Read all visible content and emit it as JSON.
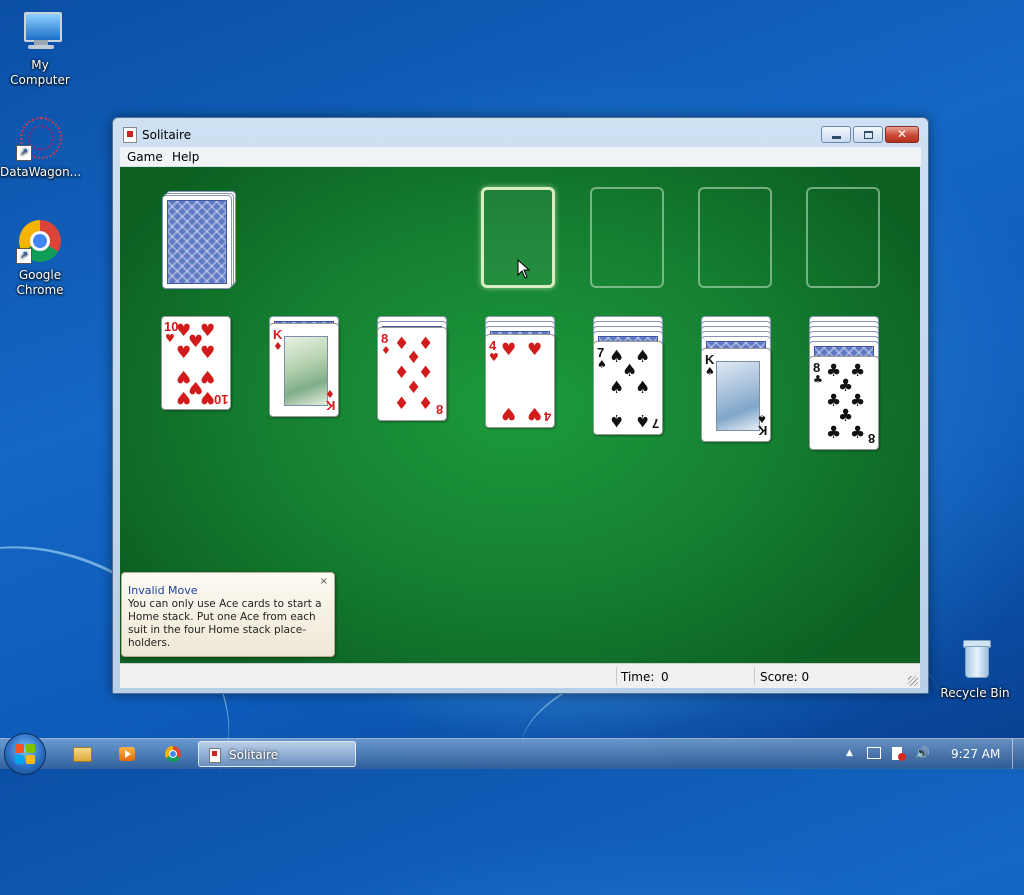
{
  "desktop": {
    "icons": [
      {
        "label": "My Computer"
      },
      {
        "label": "DataWagon..."
      },
      {
        "label": "Google Chrome"
      },
      {
        "label": "Recycle Bin"
      }
    ]
  },
  "window": {
    "title": "Solitaire",
    "menu": [
      "Game",
      "Help"
    ]
  },
  "game": {
    "tableau": [
      {
        "face_down": 0,
        "rank": "10",
        "suit": "hearts"
      },
      {
        "face_down": 1,
        "rank": "K",
        "suit": "diamonds"
      },
      {
        "face_down": 2,
        "rank": "8",
        "suit": "diamonds"
      },
      {
        "face_down": 3,
        "rank": "4",
        "suit": "hearts"
      },
      {
        "face_down": 4,
        "rank": "7",
        "suit": "spades"
      },
      {
        "face_down": 5,
        "rank": "K",
        "suit": "spades"
      },
      {
        "face_down": 6,
        "rank": "8",
        "suit": "clubs"
      }
    ],
    "foundations_empty": 4,
    "highlighted_foundation": 1
  },
  "notification": {
    "title": "Invalid Move",
    "text": "You can only use Ace cards to start a Home stack. Put one Ace from each suit in the four Home stack place-holders.",
    "close": "×"
  },
  "status": {
    "time_label": "Time:",
    "time_value": "0",
    "score_label": "Score: 0"
  },
  "taskbar": {
    "task_label": "Solitaire",
    "clock": "9:27 AM"
  }
}
